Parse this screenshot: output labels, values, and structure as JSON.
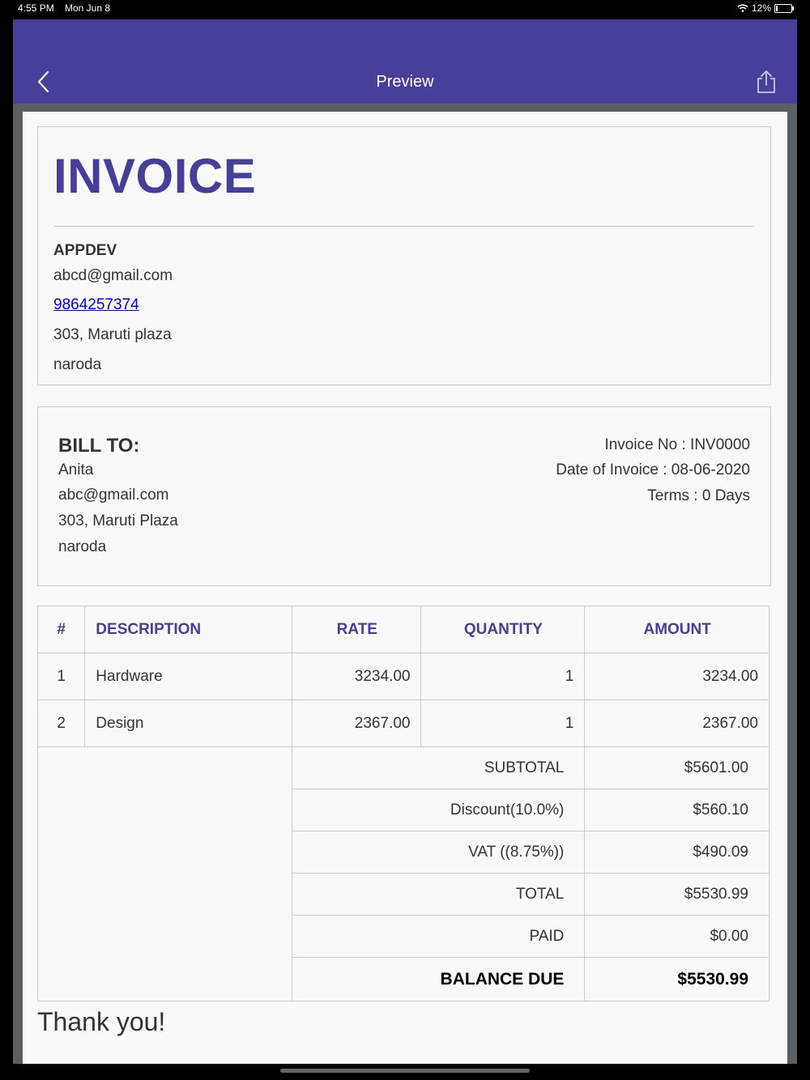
{
  "status_bar": {
    "time": "4:55 PM",
    "date": "Mon Jun 8",
    "battery": "12%"
  },
  "nav": {
    "title": "Preview",
    "back_icon": "chevron-left-icon",
    "share_icon": "share-icon"
  },
  "invoice": {
    "heading": "INVOICE",
    "company": {
      "name": "APPDEV",
      "email": "abcd@gmail.com",
      "phone": "9864257374",
      "address_line1": "303, Maruti plaza",
      "address_line2": "naroda"
    },
    "bill_to": {
      "label": "BILL TO:",
      "name": "Anita",
      "email": "abc@gmail.com",
      "address_line1": "303, Maruti Plaza",
      "address_line2": "naroda"
    },
    "meta": {
      "invoice_no": "Invoice No : INV0000",
      "date": "Date of Invoice : 08-06-2020",
      "terms": "Terms : 0 Days"
    },
    "table": {
      "headers": {
        "num": "#",
        "description": "DESCRIPTION",
        "rate": "RATE",
        "quantity": "QUANTITY",
        "amount": "AMOUNT"
      },
      "rows": [
        {
          "num": "1",
          "description": "Hardware",
          "rate": "3234.00",
          "quantity": "1",
          "amount": "3234.00"
        },
        {
          "num": "2",
          "description": "Design",
          "rate": "2367.00",
          "quantity": "1",
          "amount": "2367.00"
        }
      ]
    },
    "summary": {
      "subtotal_label": "SUBTOTAL",
      "subtotal": "$5601.00",
      "discount_label": "Discount(10.0%)",
      "discount": "$560.10",
      "vat_label": "VAT ((8.75%))",
      "vat": "$490.09",
      "total_label": "TOTAL",
      "total": "$5530.99",
      "paid_label": "PAID",
      "paid": "$0.00",
      "balance_label": "BALANCE DUE",
      "balance": "$5530.99"
    },
    "thanks": "Thank you!"
  },
  "colors": {
    "nav_bg": "#46409b",
    "accent": "#453f9a",
    "link": "#0000ee"
  }
}
